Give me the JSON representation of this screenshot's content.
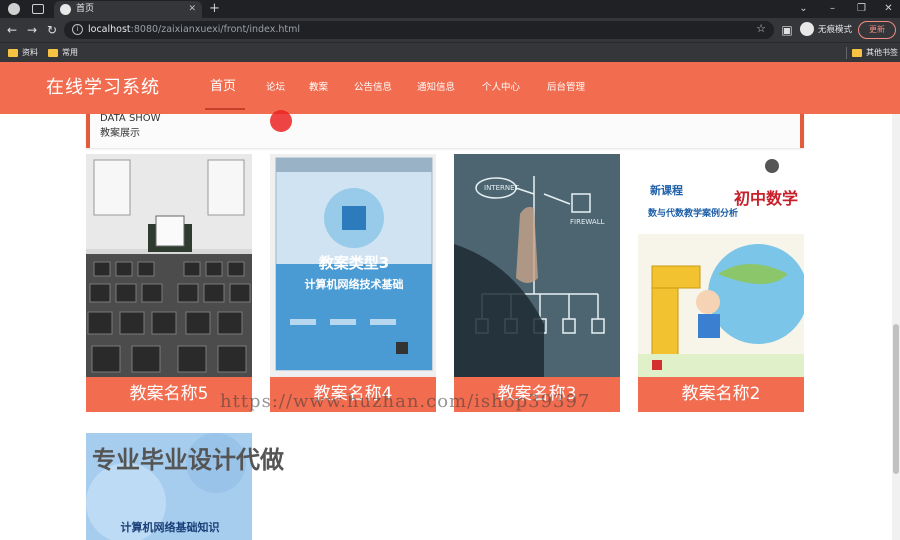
{
  "browser": {
    "tab_title": "首页",
    "tab_close": "✕",
    "new_tab": "+",
    "url_host": "localhost",
    "url_rest": ":8080/zaixianxuexi/front/index.html",
    "incognito_label": "无痕模式",
    "update_label": "更新",
    "bookmarks": [
      "资料",
      "常用"
    ],
    "other_bookmarks": "其他书签"
  },
  "site": {
    "brand": "在线学习系统",
    "nav": [
      "首页",
      "论坛",
      "教案",
      "公告信息",
      "通知信息",
      "个人中心",
      "后台管理"
    ]
  },
  "section": {
    "title_en": "DATA SHOW",
    "title_cn": "教案展示"
  },
  "cards": [
    {
      "caption": "教案名称5"
    },
    {
      "caption": "教案名称4",
      "book_title": "教案类型3",
      "book_subtitle": "计算机网络技术基础"
    },
    {
      "caption": "教案名称3",
      "diagram_labels": [
        "INTERNET",
        "FIREWALL"
      ]
    },
    {
      "caption": "教案名称2",
      "cover_tag": "新课程",
      "cover_title": "初中数学",
      "cover_subtitle": "数与代数教学案例分析"
    }
  ],
  "second_row": {
    "book_title": "计算机网络基础知识"
  },
  "overlay": {
    "watermark": "https://www.huzhan.com/ishop39397",
    "promo": "专业毕业设计代做"
  },
  "colors": {
    "primary": "#f26c4f",
    "accent": "#e25c3c"
  }
}
